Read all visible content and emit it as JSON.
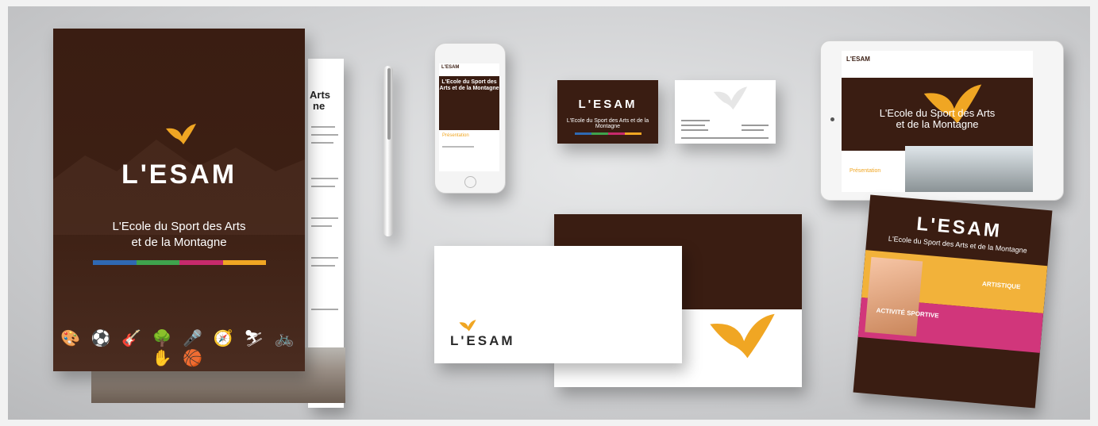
{
  "brochure": {
    "logo": "L'ESAM",
    "tagline_line1": "L'Ecole du Sport des Arts",
    "tagline_line2": "et de la Montagne",
    "icons": "🎨 ⚽ 🎸 🌳 🎤 🧭 ⛷ 🚲 ✋ 🏀",
    "back_page_fragment_1": "Arts",
    "back_page_fragment_2": "ne"
  },
  "phone_screen": {
    "logo": "L'ESAM",
    "tagline": "L'Ecole du Sport des Arts et de la Montagne",
    "section_label": "Présentation"
  },
  "business_card": {
    "logo": "L'ESAM",
    "tagline": "L'Ecole du Sport des Arts et de la Montagne"
  },
  "tablet_screen": {
    "logo": "L'ESAM",
    "tagline_line1": "L'Ecole du Sport des Arts",
    "tagline_line2": "et de la Montagne",
    "section_label": "Présentation"
  },
  "envelope": {
    "logo": "L'ESAM"
  },
  "flyer": {
    "logo": "L'ESAM",
    "tagline": "L'Ecole du Sport des Arts et de la Montagne",
    "section_orange": "ARTISTIQUE",
    "section_pink": "ACTIVITÉ SPORTIVE"
  },
  "colors": {
    "brand_brown": "#3a1d12",
    "brand_orange": "#f0a623",
    "stripe_blue": "#2f69b3",
    "stripe_green": "#3fa34d",
    "stripe_pink": "#c72a6c",
    "stripe_yellow": "#f0a623"
  }
}
